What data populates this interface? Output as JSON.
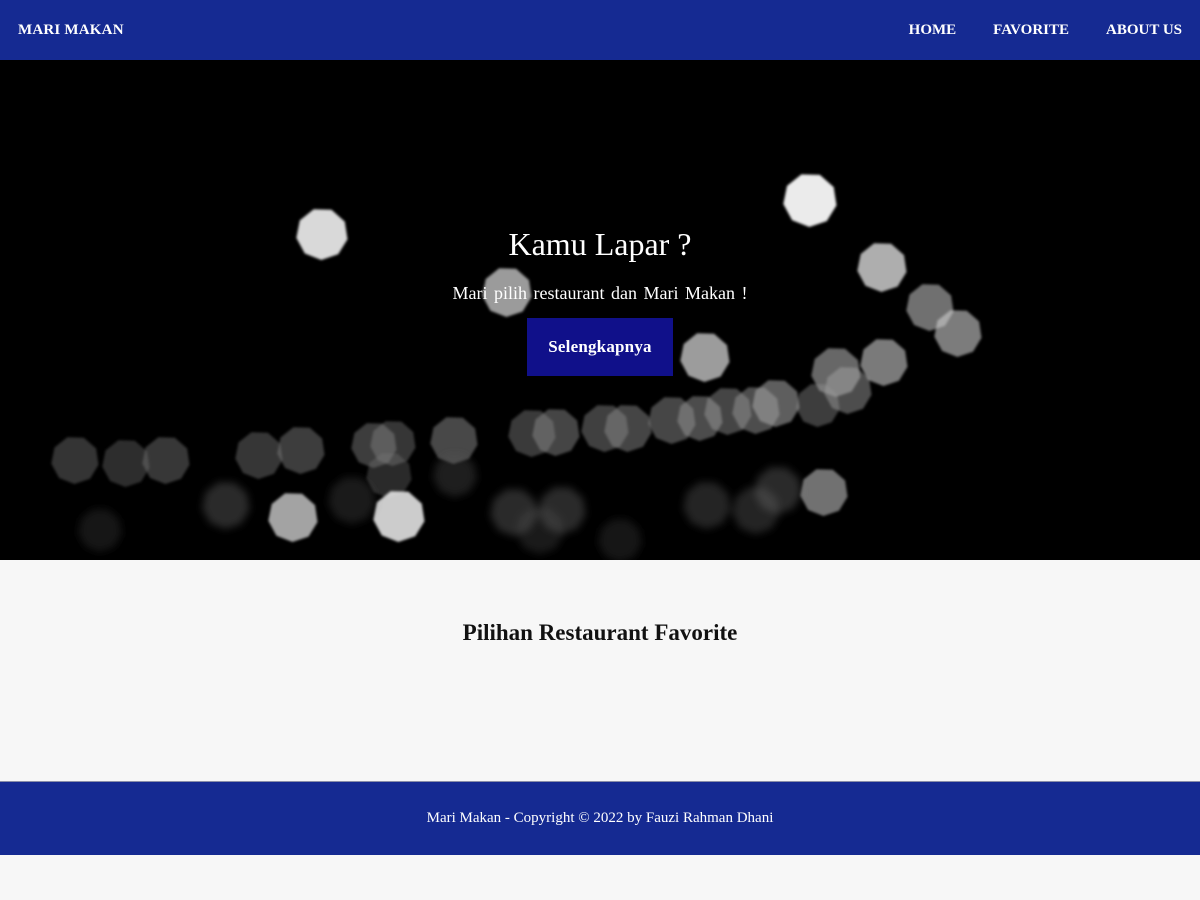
{
  "navbar": {
    "brand": "MARI MAKAN",
    "links": [
      "HOME",
      "FAVORITE",
      "ABOUT US"
    ],
    "background": "#152a92"
  },
  "hero": {
    "title": "Kamu Lapar ?",
    "subtitle": "Mari pilih restaurant dan Mari Makan !",
    "button_label": "Selengkapnya",
    "button_color": "#10108a",
    "background_image": "bokeh-lights-dark"
  },
  "main": {
    "section_title": "Pilihan Restaurant Favorite"
  },
  "footer": {
    "text": "Mari Makan - Copyright © 2022 by Fauzi Rahman Dhani"
  }
}
